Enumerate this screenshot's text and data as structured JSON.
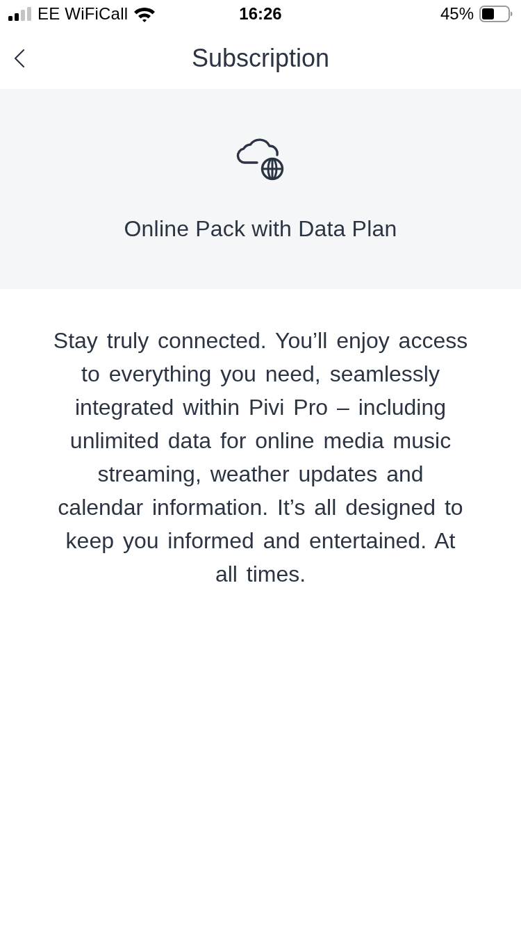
{
  "status_bar": {
    "carrier": "EE WiFiCall",
    "time": "16:26",
    "battery": "45%"
  },
  "header": {
    "title": "Subscription"
  },
  "plan": {
    "title": "Online Pack with Data Plan"
  },
  "description": "Stay truly connected. You’ll enjoy access to everything you need, seamlessly integrated within Pivi Pro – including unlimited data for online media music streaming, weather updates and calendar information. It’s all designed to keep you informed and entertained. At all times."
}
